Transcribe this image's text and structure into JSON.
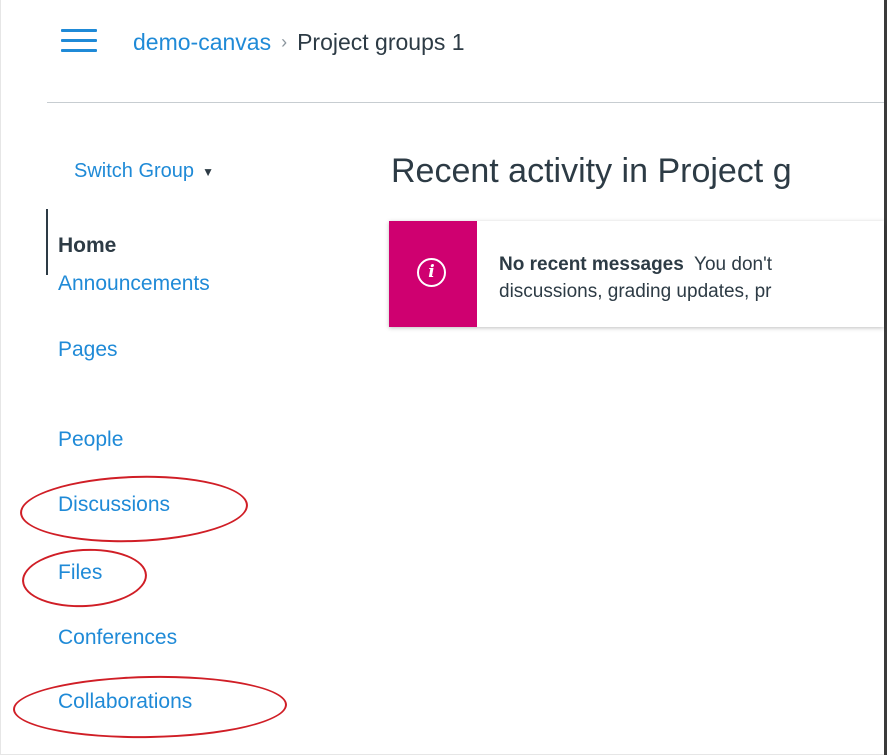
{
  "header": {
    "breadcrumb": {
      "course": "demo-canvas",
      "separator": "›",
      "current": "Project groups 1"
    }
  },
  "sidebar": {
    "switch_group": {
      "label": "Switch Group",
      "caret": "▼"
    },
    "items": [
      {
        "label": "Home",
        "active": true
      },
      {
        "label": "Announcements"
      },
      {
        "label": "Pages"
      },
      {
        "label": "People"
      },
      {
        "label": "Discussions",
        "highlighted": true
      },
      {
        "label": "Files",
        "highlighted": true
      },
      {
        "label": "Conferences"
      },
      {
        "label": "Collaborations",
        "highlighted": true
      }
    ]
  },
  "main": {
    "title": "Recent activity in Project g",
    "alert": {
      "icon": "info-icon",
      "icon_glyph": "i",
      "heading": "No recent messages",
      "text_line1": "You don't",
      "text_line2": "discussions, grading updates, pr"
    }
  },
  "colors": {
    "link": "#1f8ad7",
    "text": "#2d3b45",
    "alert_accent": "#cf0070",
    "annotation": "#d01e26"
  }
}
